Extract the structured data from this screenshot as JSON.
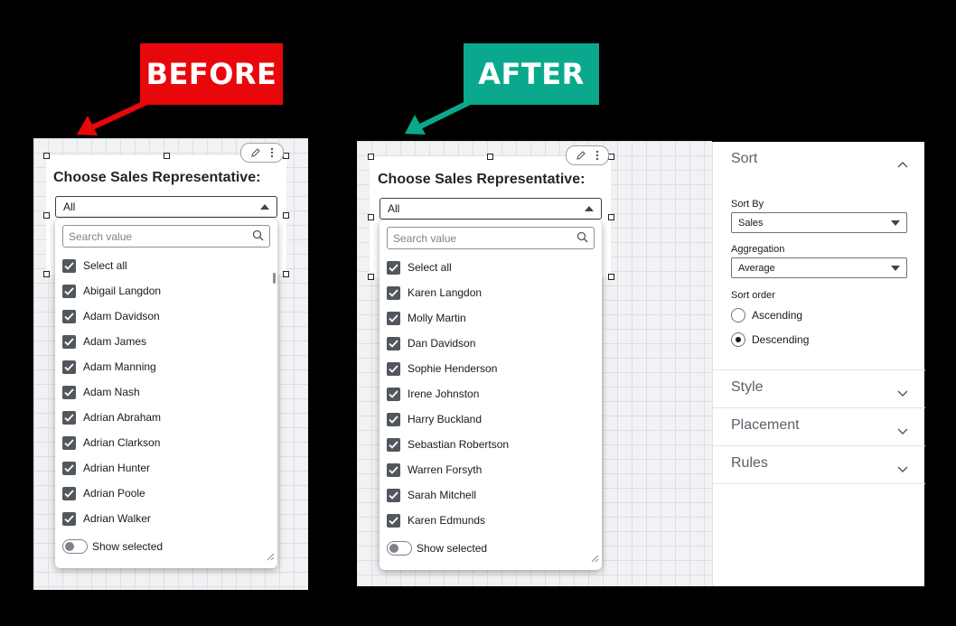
{
  "labels": {
    "before": "BEFORE",
    "after": "AFTER"
  },
  "colors": {
    "before": "#e8070b",
    "after": "#0aa98d"
  },
  "widget": {
    "title": "Choose Sales Representative:",
    "selected_value": "All",
    "search_placeholder": "Search value",
    "select_all": "Select all",
    "show_selected": "Show selected"
  },
  "before_items": [
    "Abigail Langdon",
    "Adam Davidson",
    "Adam James",
    "Adam Manning",
    "Adam Nash",
    "Adrian Abraham",
    "Adrian Clarkson",
    "Adrian Hunter",
    "Adrian Poole",
    "Adrian Walker"
  ],
  "after_items": [
    "Karen Langdon",
    "Molly Martin",
    "Dan Davidson",
    "Sophie Henderson",
    "Irene Johnston",
    "Harry Buckland",
    "Sebastian Robertson",
    "Warren Forsyth",
    "Sarah Mitchell",
    "Karen Edmunds"
  ],
  "panel": {
    "sort": {
      "title": "Sort",
      "sort_by_label": "Sort By",
      "sort_by_value": "Sales",
      "aggregation_label": "Aggregation",
      "aggregation_value": "Average",
      "sort_order_label": "Sort order",
      "ascending": "Ascending",
      "descending": "Descending",
      "selected_order": "Descending"
    },
    "style": "Style",
    "placement": "Placement",
    "rules": "Rules"
  }
}
